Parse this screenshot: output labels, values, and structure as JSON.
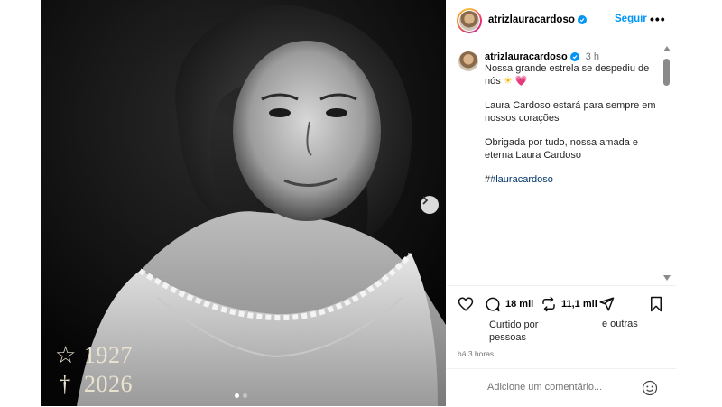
{
  "photo": {
    "birth_symbol": "☆",
    "birth_year": "1927",
    "death_symbol": "†",
    "death_year": "2026",
    "slide_count": 2,
    "active_slide": 0
  },
  "header": {
    "username": "atrizlauracardoso",
    "follow_label": "Seguir",
    "more_label": "•••"
  },
  "caption": {
    "username": "atrizlauracardoso",
    "time": "3 h",
    "line1": "Nossa grande estrela se despediu de nós",
    "emoji_sun": "☀",
    "emoji_heart": "💗",
    "para2": "Laura Cardoso estará para sempre em nossos corações",
    "para3": "Obrigada por tudo, nossa amada e eterna Laura Cardoso",
    "hashtag_prefix": "#",
    "hashtag": "#lauracardoso"
  },
  "actions": {
    "comments_count": "18 mil",
    "reposts_count": "11,1 mil",
    "liked_by": "Curtido por pessoas",
    "and_others": "e outras",
    "time_ago": "há 3 horas"
  },
  "comment_box": {
    "placeholder": "Adicione um comentário..."
  },
  "icons": [
    "heart-icon",
    "comment-icon",
    "repost-icon",
    "share-icon",
    "bookmark-icon",
    "emoji-icon",
    "verified-icon",
    "next-arrow-icon"
  ]
}
